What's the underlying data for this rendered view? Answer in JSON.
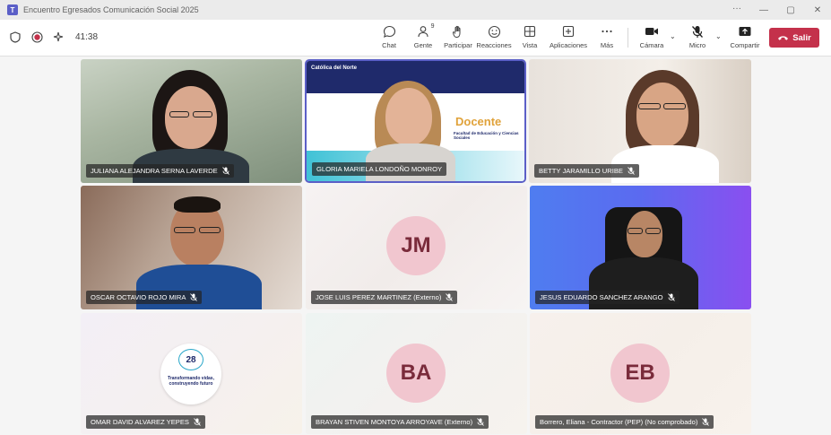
{
  "window": {
    "title": "Encuentro Egresados Comunicación Social 2025"
  },
  "toolbar": {
    "timer": "41:38",
    "buttons": {
      "chat": "Chat",
      "people": "Gente",
      "people_count": "9",
      "raise": "Participar",
      "react": "Reacciones",
      "view": "Vista",
      "apps": "Aplicaciones",
      "more": "Más",
      "camera": "Cámara",
      "mic": "Micro",
      "share": "Compartir",
      "leave": "Salir"
    }
  },
  "participants": [
    {
      "name": "JULIANA ALEJANDRA SERNA LAVERDE",
      "type": "video"
    },
    {
      "name": "GLORIA MARIELA LONDOÑO MONROY",
      "type": "video",
      "active": true,
      "slide": {
        "brand": "Católica del Norte",
        "heading": "Docente",
        "subheading": "Facultad de Educación y Ciencias Sociales"
      }
    },
    {
      "name": "BETTY JARAMILLO URIBE",
      "type": "video"
    },
    {
      "name": "OSCAR OCTAVIO ROJO MIRA",
      "type": "video"
    },
    {
      "name": "JOSE LUIS PEREZ MARTINEZ (Externo)",
      "type": "avatar",
      "initials": "JM"
    },
    {
      "name": "JESUS EDUARDO SANCHEZ ARANGO",
      "type": "video"
    },
    {
      "name": "OMAR DAVID ALVAREZ YEPES",
      "type": "logo",
      "logo": {
        "number": "28",
        "tagline": "Transformando vidas, construyendo futuro"
      }
    },
    {
      "name": "BRAYAN STIVEN MONTOYA ARROYAVE (Externo)",
      "type": "avatar",
      "initials": "BA"
    },
    {
      "name": "Borrero, Eliana - Contractor (PEP) (No comprobado)",
      "type": "avatar",
      "initials": "EB"
    }
  ],
  "colors": {
    "accent": "#5b5fc7",
    "leave": "#c4314b",
    "avatar_bg": "#f1c6cf",
    "avatar_text": "#7a2b3b"
  }
}
